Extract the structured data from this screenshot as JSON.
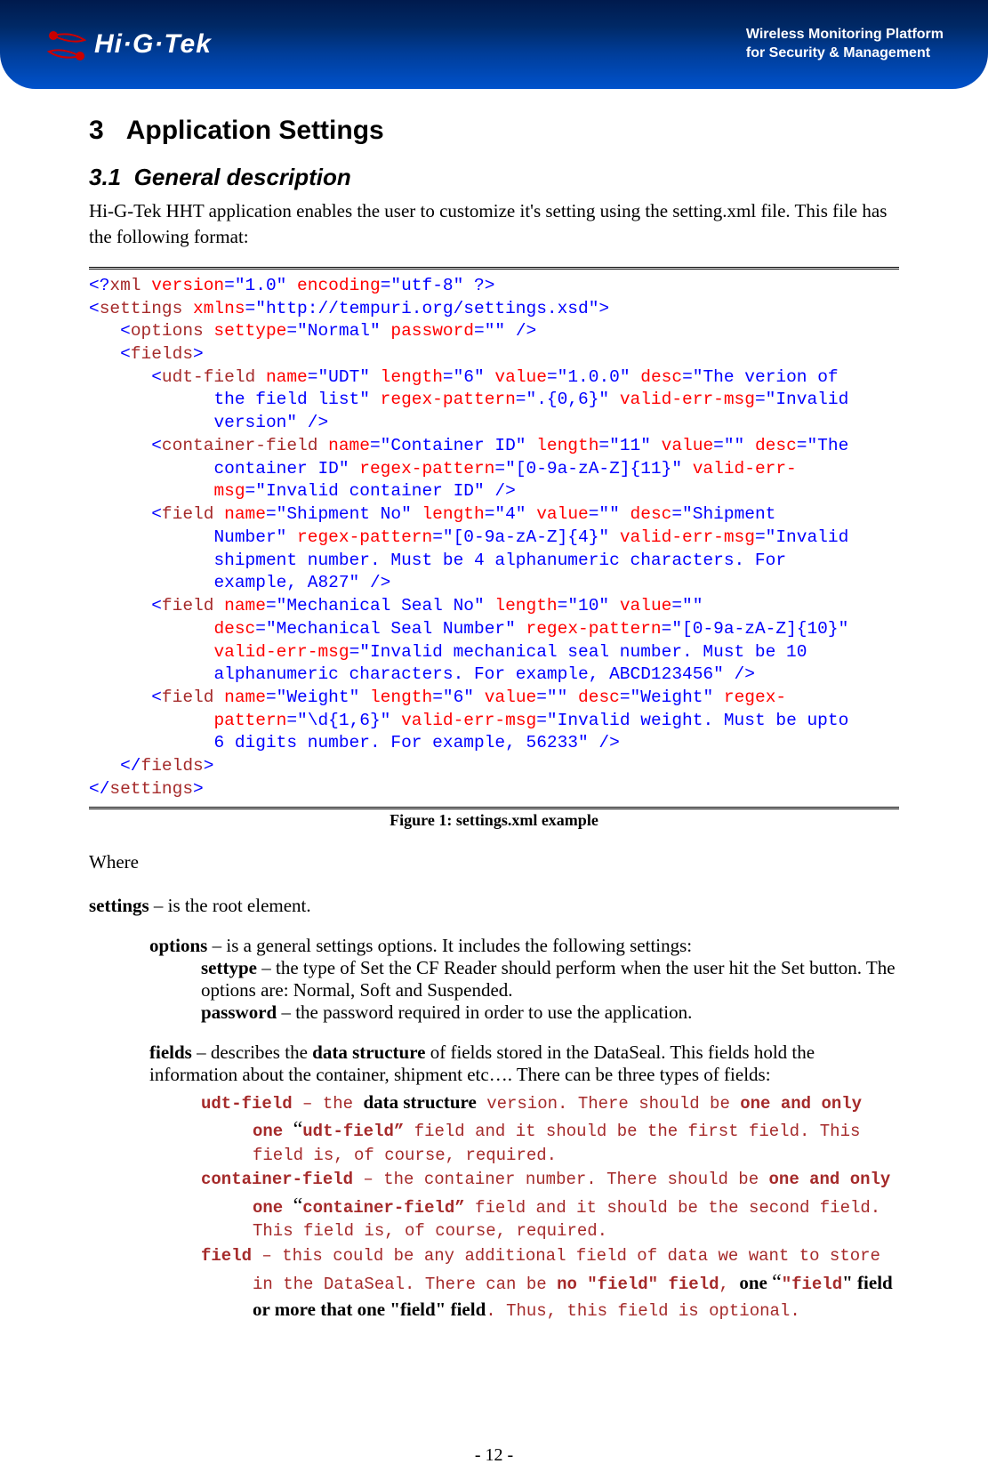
{
  "header": {
    "logo_text": "Hi·G·Tek",
    "tagline_line1": "Wireless Monitoring Platform",
    "tagline_line2": "for Security & Management"
  },
  "section": {
    "number": "3",
    "title": "Application Settings",
    "sub_number": "3.1",
    "sub_title": "General description",
    "intro": "Hi-G-Tek HHT application enables the user to customize it's setting using the setting.xml file. This file has the following format:"
  },
  "code": {
    "l1a": "<?",
    "l1b": "xml",
    "l1c": " version",
    "l1d": "=\"1.0\"",
    "l1e": " encoding",
    "l1f": "=\"utf-8\" ?>",
    "l2a": "<",
    "l2b": "settings",
    "l2c": " xmlns",
    "l2d": "=\"http://tempuri.org/settings.xsd\">",
    "l3a": "   <",
    "l3b": "options",
    "l3c": " settype",
    "l3d": "=\"Normal\"",
    "l3e": " password",
    "l3f": "=\"\" />",
    "l4a": "   <",
    "l4b": "fields",
    "l4c": ">",
    "l5a": "      <",
    "l5b": "udt-field",
    "l5c": " name",
    "l5d": "=\"UDT\"",
    "l5e": " length",
    "l5f": "=\"6\"",
    "l5g": " value",
    "l5h": "=\"1.0.0\"",
    "l5i": " desc",
    "l5j": "=\"The verion of",
    "l6": "            the field list\"",
    "l6b": " regex-pattern",
    "l6c": "=\".{0,6}\"",
    "l6d": " valid-err-msg",
    "l6e": "=\"Invalid",
    "l7": "            version\" />",
    "l8a": "      <",
    "l8b": "container-field",
    "l8c": " name",
    "l8d": "=\"Container ID\"",
    "l8e": " length",
    "l8f": "=\"11\"",
    "l8g": " value",
    "l8h": "=\"\"",
    "l8i": " desc",
    "l8j": "=\"The",
    "l9": "            container ID\"",
    "l9b": " regex-pattern",
    "l9c": "=\"[0-9a-zA-Z]{11}\"",
    "l9d": " valid-err-",
    "l10": "            msg",
    "l10b": "=\"Invalid container ID\" />",
    "l11a": "      <",
    "l11b": "field",
    "l11c": " name",
    "l11d": "=\"Shipment No\"",
    "l11e": " length",
    "l11f": "=\"4\"",
    "l11g": " value",
    "l11h": "=\"\"",
    "l11i": " desc",
    "l11j": "=\"Shipment",
    "l12": "            Number\"",
    "l12b": " regex-pattern",
    "l12c": "=\"[0-9a-zA-Z]{4}\"",
    "l12d": " valid-err-msg",
    "l12e": "=\"Invalid",
    "l13": "            shipment number. Must be 4 alphanumeric characters. For",
    "l14": "            example, A827\" />",
    "l15a": "      <",
    "l15b": "field",
    "l15c": " name",
    "l15d": "=\"Mechanical Seal No\"",
    "l15e": " length",
    "l15f": "=\"10\"",
    "l15g": " value",
    "l15h": "=\"\"",
    "l16a": "            desc",
    "l16b": "=\"Mechanical Seal Number\"",
    "l16c": " regex-pattern",
    "l16d": "=\"[0-9a-zA-Z]{10}\"",
    "l17a": "            valid-err-msg",
    "l17b": "=\"Invalid mechanical seal number. Must be 10",
    "l18": "            alphanumeric characters. For example, ABCD123456\" />",
    "l19a": "      <",
    "l19b": "field",
    "l19c": " name",
    "l19d": "=\"Weight\"",
    "l19e": " length",
    "l19f": "=\"6\"",
    "l19g": " value",
    "l19h": "=\"\"",
    "l19i": " desc",
    "l19j": "=\"Weight\"",
    "l19k": " regex-",
    "l20a": "            pattern",
    "l20b": "=\"\\d{1,6}\"",
    "l20c": " valid-err-msg",
    "l20d": "=\"Invalid weight. Must be upto",
    "l21": "            6 digits number. For example, 56233\" />",
    "l22a": "   </",
    "l22b": "fields",
    "l22c": ">",
    "l23a": "</",
    "l23b": "settings",
    "l23c": ">"
  },
  "figure_caption": "Figure 1: settings.xml  example",
  "where_label": "Where",
  "defs": {
    "settings": "settings",
    "settings_desc": " – is the root element.",
    "options": "options",
    "options_desc": " – is a general settings options. It includes the following settings:",
    "settype": "settype",
    "settype_desc": " – the type of Set the CF Reader should perform when the user hit the Set button. The options are: Normal, Soft and Suspended.",
    "password": "password",
    "password_desc": " – the password required in order to use the application.",
    "fields": "fields",
    "fields_desc_a": " – describes the ",
    "fields_desc_b": "data structure",
    "fields_desc_c": " of fields stored in the DataSeal. This fields hold the information about the container, shipment etc…. There can be three types of fields:",
    "udt_a": "udt-field",
    "udt_b": " – the ",
    "udt_c": "data structure",
    "udt_d": " version. There should be ",
    "udt_e": "one and only one ",
    "udt_f": "\"udt-field\"",
    "udt_g": " field and it should be the first field. This field is, of course, required.",
    "cont_a": "container-field",
    "cont_b": " – the container number. There should be ",
    "cont_c": "one and only one ",
    "cont_d": "\"container-field\"",
    "cont_e": " field and it should be the second field. This field is, of course, required.",
    "field_a": "field",
    "field_b": " – this could be any additional field of data we want to store in the DataSeal. There can be ",
    "field_c": "no \"field\" field",
    "field_d": ", ",
    "field_e": "one ",
    "field_f": "\"field",
    "field_g": "\" field or more that one \"field\" field",
    "field_h": ". Thus, this field is optional."
  },
  "page_number": "- 12 -"
}
